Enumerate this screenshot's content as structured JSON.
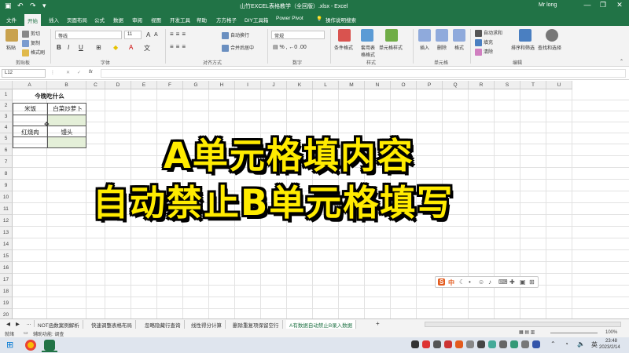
{
  "title_bar": {
    "title": "山竹EXCEL表格教学（全回版）.xlsx - Excel",
    "user": "Mr long",
    "min": "—",
    "max": "❐",
    "close": "✕"
  },
  "tabs": [
    "文件",
    "开始",
    "插入",
    "页面布局",
    "公式",
    "数据",
    "审阅",
    "视图",
    "开发工具",
    "帮助",
    "方方格子",
    "DIY工具箱",
    "Power Pivot",
    "操作说明搜索"
  ],
  "ribbon": {
    "clipboard": {
      "cut": "剪切",
      "copy": "复制",
      "paste": "粘贴",
      "format_painter": "格式刷",
      "label": "剪贴板"
    },
    "font": {
      "name": "等线",
      "size": "11",
      "bold": "B",
      "italic": "I",
      "underline": "U",
      "label": "字体"
    },
    "alignment": {
      "wrap": "自动换行",
      "merge": "合并后居中",
      "label": "对齐方式"
    },
    "number": {
      "format": "常规",
      "label": "数字"
    },
    "styles": {
      "conditional": "条件格式",
      "table": "套用表格格式",
      "cell_styles": "单元格样式",
      "label": "样式"
    },
    "cells": {
      "insert": "插入",
      "delete": "删除",
      "format": "格式",
      "label": "单元格"
    },
    "editing": {
      "autosum": "自动求和",
      "fill": "填充",
      "clear": "清除",
      "sort": "排序和筛选",
      "find": "查找和选择",
      "label": "编辑"
    }
  },
  "formula_bar": {
    "name_box": "L12",
    "fx": "fx",
    "content": ""
  },
  "columns": [
    "A",
    "B",
    "C",
    "D",
    "E",
    "F",
    "G",
    "H",
    "I",
    "J",
    "K",
    "L",
    "M",
    "N",
    "O",
    "P",
    "Q",
    "R",
    "S",
    "T",
    "U"
  ],
  "rows": [
    "1",
    "2",
    "3",
    "4",
    "5",
    "6",
    "7",
    "8",
    "9",
    "10",
    "11",
    "12",
    "13",
    "14",
    "15",
    "16",
    "17",
    "18",
    "19",
    "20"
  ],
  "cells": {
    "title": "今晚吃什么",
    "a2": "米饭",
    "b2": "白菜炒萝卜",
    "a4": "红烧肉",
    "b4": "馒头"
  },
  "banner": {
    "line1": "A单元格填内容",
    "line2": "自动禁止B单元格填写"
  },
  "ime": {
    "logo": "S",
    "lang": "中"
  },
  "sheet_tabs": {
    "nav": [
      "◀",
      "▶",
      "..."
    ],
    "tabs": [
      "NOT函数案例解析",
      "快速调整表格布局",
      "忽略隐藏行查询",
      "线性得分计算",
      "删除重复项保留空行",
      "A有数据自动禁止B录入数据"
    ],
    "add": "+"
  },
  "status": {
    "ready": "就绪",
    "access": "辅助功能: 调查",
    "zoom": "100%"
  },
  "taskbar": {
    "time": "23:48",
    "date": "2023/2/14"
  },
  "colors": {
    "excel_green": "#217346",
    "banner_yellow": "#ffeb00"
  }
}
